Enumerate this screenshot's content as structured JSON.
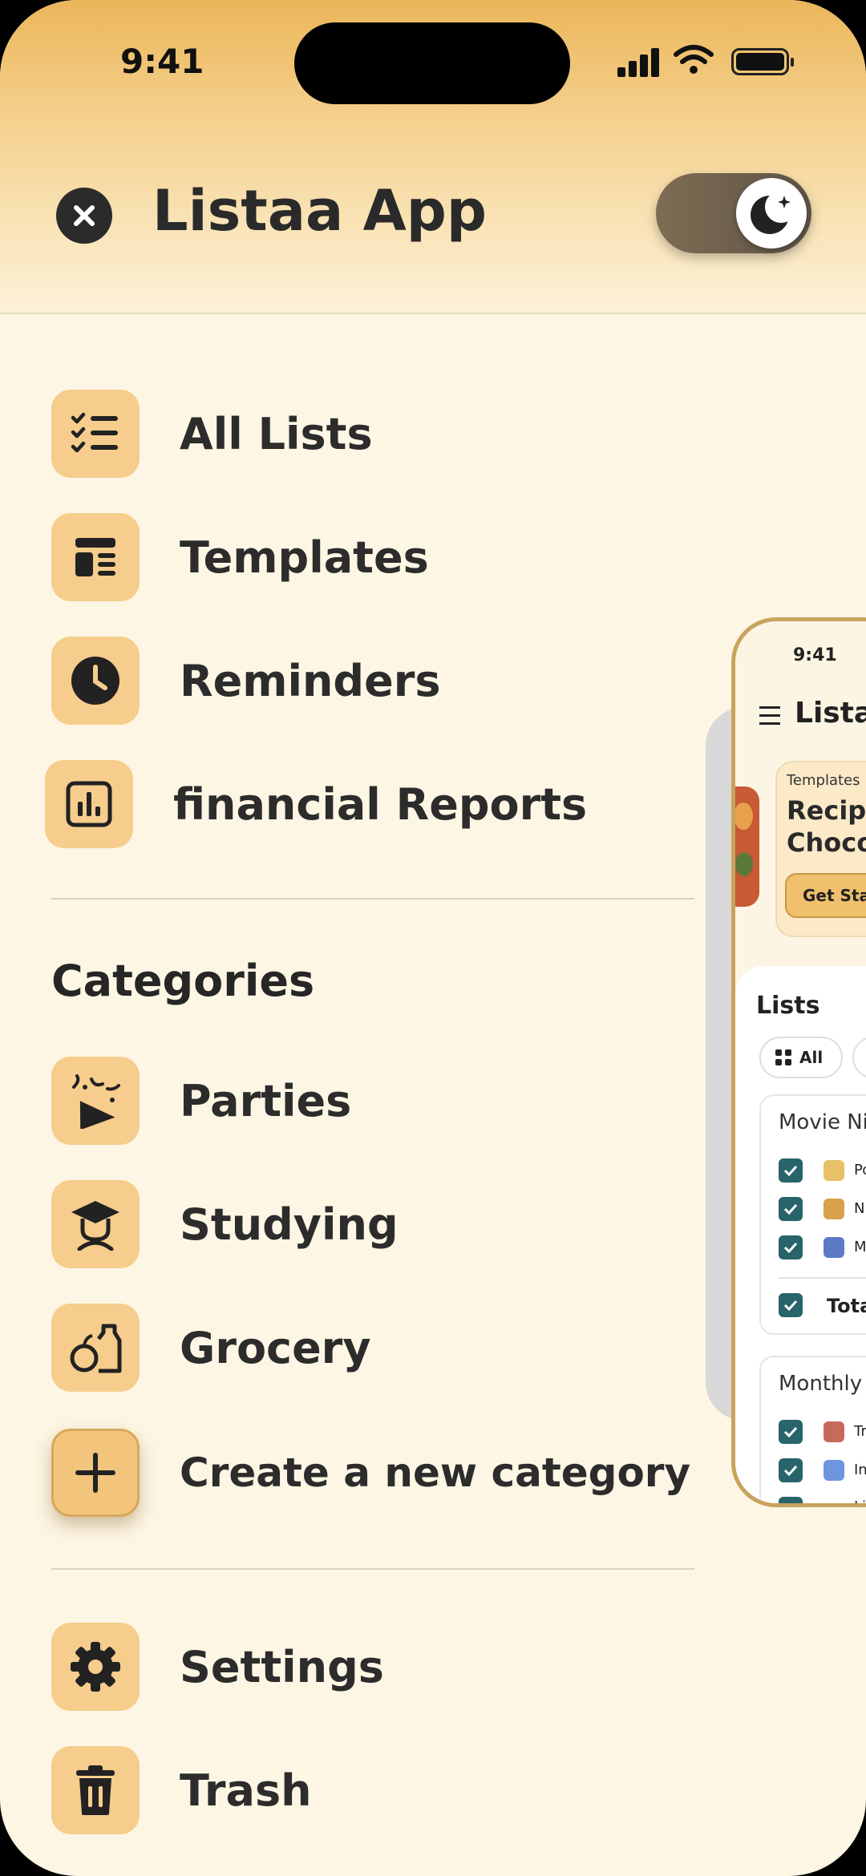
{
  "status_bar": {
    "time": "9:41"
  },
  "header": {
    "title": "Listaa App"
  },
  "menu": {
    "items": [
      {
        "label": "All Lists",
        "icon": "checklist-icon"
      },
      {
        "label": "Templates",
        "icon": "template-icon"
      },
      {
        "label": "Reminders",
        "icon": "clock-icon"
      },
      {
        "label": "financial Reports",
        "icon": "bar-chart-icon"
      }
    ]
  },
  "categories": {
    "title": "Categories",
    "items": [
      {
        "label": "Parties",
        "icon": "party-popper-icon"
      },
      {
        "label": "Studying",
        "icon": "graduation-cap-icon"
      },
      {
        "label": "Grocery",
        "icon": "grocery-icon"
      }
    ],
    "create_label": "Create a new category"
  },
  "footer_menu": {
    "items": [
      {
        "label": "Settings",
        "icon": "gear-icon"
      },
      {
        "label": "Trash",
        "icon": "trash-icon"
      }
    ]
  },
  "preview": {
    "time": "9:41",
    "title": "Listaa",
    "card": {
      "tag": "Templates",
      "title_line1": "Recipe",
      "title_line2": "Choco",
      "button": "Get Sta"
    },
    "lists_title": "Lists",
    "chip_all": "All",
    "list1": {
      "title": "Movie Ni",
      "items": [
        "Po",
        "N",
        "M"
      ],
      "total": "Tota"
    },
    "list2": {
      "title": "Monthly",
      "items": [
        "Tr",
        "In",
        "Li"
      ]
    }
  },
  "colors": {
    "accent": "#f6cd8c",
    "header_gradient_top": "#ebb65a",
    "background": "#fdf6e4",
    "text": "#2c2c2c",
    "check": "#28646a"
  }
}
